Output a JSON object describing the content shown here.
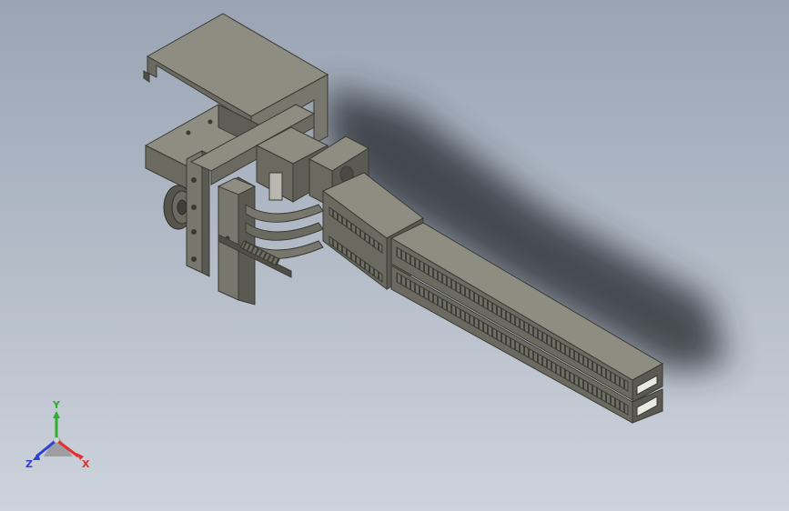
{
  "viewport": {
    "background_top": "#9aa4b4",
    "background_bottom": "#cdd3dc",
    "model_color": "#77776d",
    "model_dark": "#4f4f48",
    "model_light": "#8d8d82"
  },
  "triad": {
    "x_label": "X",
    "y_label": "Y",
    "z_label": "Z",
    "x_color": "#e03030",
    "y_color": "#2fae2f",
    "z_color": "#2f3fd8"
  }
}
